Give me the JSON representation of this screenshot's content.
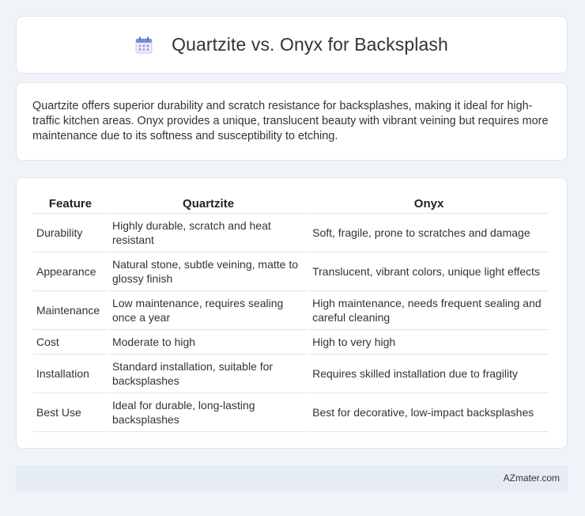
{
  "header": {
    "icon": "calendar-icon",
    "title": "Quartzite vs. Onyx for Backsplash"
  },
  "intro": {
    "text": "Quartzite offers superior durability and scratch resistance for backsplashes, making it ideal for high-traffic kitchen areas. Onyx provides a unique, translucent beauty with vibrant veining but requires more maintenance due to its softness and susceptibility to etching."
  },
  "table": {
    "headers": [
      "Feature",
      "Quartzite",
      "Onyx"
    ],
    "rows": [
      [
        "Durability",
        "Highly durable, scratch and heat resistant",
        "Soft, fragile, prone to scratches and damage"
      ],
      [
        "Appearance",
        "Natural stone, subtle veining, matte to glossy finish",
        "Translucent, vibrant colors, unique light effects"
      ],
      [
        "Maintenance",
        "Low maintenance, requires sealing once a year",
        "High maintenance, needs frequent sealing and careful cleaning"
      ],
      [
        "Cost",
        "Moderate to high",
        "High to very high"
      ],
      [
        "Installation",
        "Standard installation, suitable for backsplashes",
        "Requires skilled installation due to fragility"
      ],
      [
        "Best Use",
        "Ideal for durable, long-lasting backsplashes",
        "Best for decorative, low-impact backsplashes"
      ]
    ]
  },
  "footer": {
    "site": "AZmater.com"
  },
  "colors": {
    "background": "#f0f3f8",
    "card": "#ffffff",
    "footer_bg": "#e6ecf6",
    "icon_accent": "#7b8fd9"
  }
}
